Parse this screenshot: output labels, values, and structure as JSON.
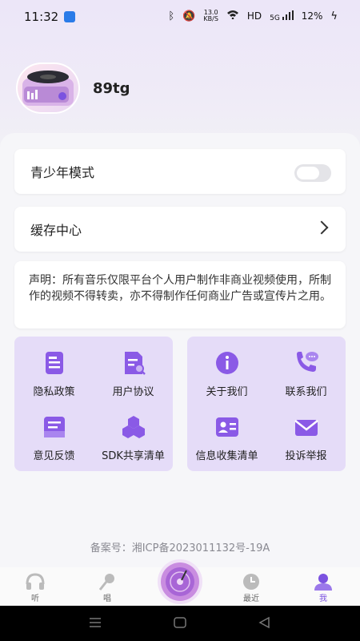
{
  "status_bar": {
    "time": "11:32",
    "network_speed": "13.0",
    "network_speed_unit": "KB/S",
    "hd": "HD",
    "signal": "5G",
    "battery": "12%"
  },
  "profile": {
    "username": "89tg"
  },
  "settings": {
    "youth_mode_label": "青少年模式",
    "youth_mode_enabled": false,
    "cache_center_label": "缓存中心"
  },
  "notice": {
    "text": "声明：所有音乐仅限平台个人用户制作非商业视频使用，所制作的视频不得转卖，亦不得制作任何商业广告或宣传片之用。"
  },
  "left_grid": {
    "items": [
      {
        "label": "隐私政策",
        "icon": "document-icon"
      },
      {
        "label": "用户协议",
        "icon": "agreement-icon"
      },
      {
        "label": "意见反馈",
        "icon": "feedback-icon"
      },
      {
        "label": "SDK共享清单",
        "icon": "sdk-cubes-icon"
      }
    ]
  },
  "right_grid": {
    "items": [
      {
        "label": "关于我们",
        "icon": "info-icon"
      },
      {
        "label": "联系我们",
        "icon": "phone-chat-icon"
      },
      {
        "label": "信息收集清单",
        "icon": "id-card-icon"
      },
      {
        "label": "投诉举报",
        "icon": "mail-icon"
      }
    ]
  },
  "footer": {
    "icp": "备案号：湘ICP备2023011132号-19A"
  },
  "tabbar": {
    "tabs": [
      {
        "label": "听",
        "icon": "headphones-icon"
      },
      {
        "label": "唱",
        "icon": "microphone-icon"
      },
      {
        "label": "",
        "icon": "record-disc-icon"
      },
      {
        "label": "最近",
        "icon": "clock-icon"
      },
      {
        "label": "我",
        "icon": "user-icon"
      }
    ],
    "active_index": 4
  },
  "colors": {
    "accent": "#7b52e0",
    "grid_bg": "#e5dcf8",
    "icon_purple": "#8a5ae6"
  }
}
